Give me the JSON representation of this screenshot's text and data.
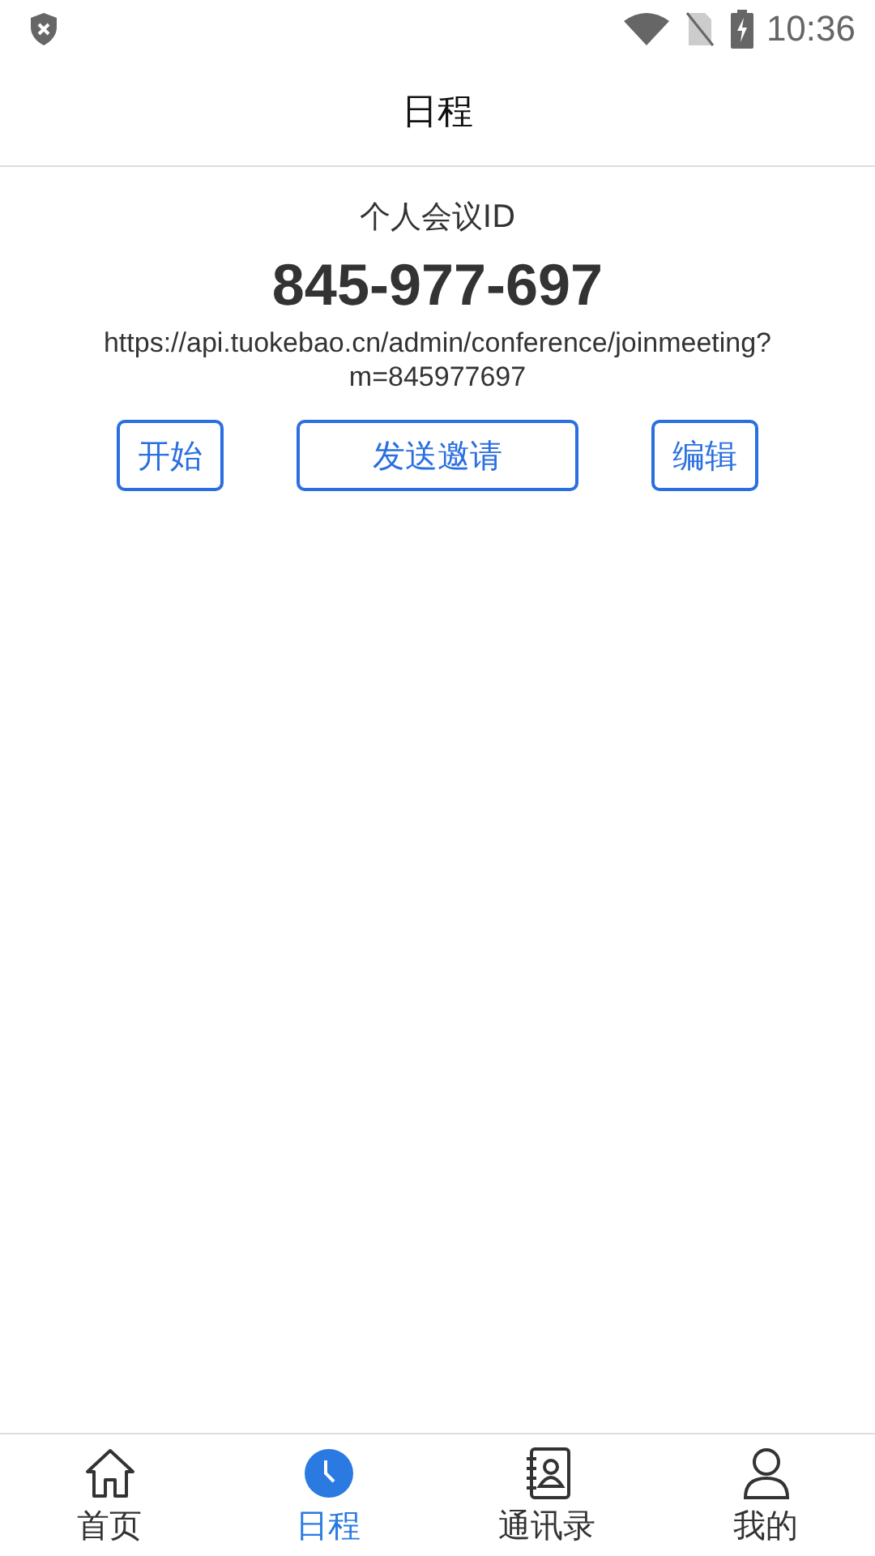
{
  "status_bar": {
    "time": "10:36"
  },
  "header": {
    "title": "日程"
  },
  "meeting": {
    "label": "个人会议ID",
    "id": "845-977-697",
    "link": "https://api.tuokebao.cn/admin/conference/joinmeeting?m=845977697"
  },
  "buttons": [
    {
      "label": "开始",
      "kind": "small"
    },
    {
      "label": "发送邀请",
      "kind": "wide"
    },
    {
      "label": "编辑",
      "kind": "small"
    }
  ],
  "tabs": [
    {
      "label": "首页",
      "kind": "home",
      "selected": false
    },
    {
      "label": "日程",
      "kind": "clock",
      "selected": true
    },
    {
      "label": "通讯录",
      "kind": "contacts",
      "selected": false
    },
    {
      "label": "我的",
      "kind": "person",
      "selected": false
    }
  ]
}
